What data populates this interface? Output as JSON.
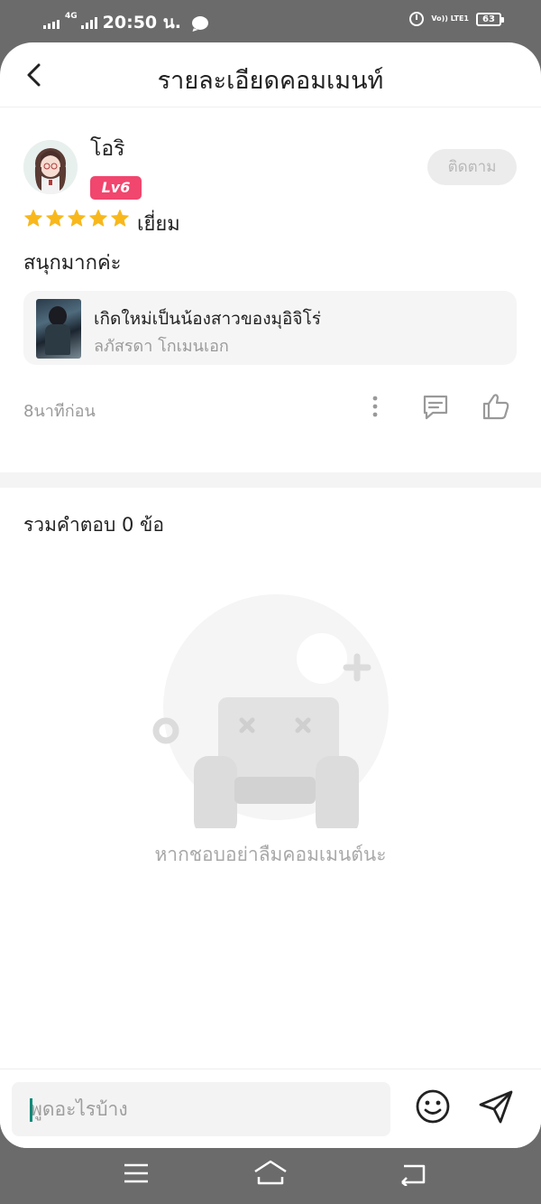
{
  "status_bar": {
    "network_label": "4G",
    "time": "20:50 น.",
    "volte_label": "Vo)) LTE1",
    "battery": "63"
  },
  "header": {
    "title": "รายละเอียดคอมเมนท์",
    "back_icon": "chevron-left-icon"
  },
  "comment": {
    "username": "โอริ",
    "level_badge": "Lv6",
    "follow_label": "ติดตาม",
    "stars": 5,
    "rating_label": "เยี่ยม",
    "text": "สนุกมากค่ะ",
    "time_ago": "8นาทีก่อน",
    "book": {
      "title": "เกิดใหม่เป็นน้องสาวของมุอิจิโร่",
      "author": "ลภัสรดา โกเมนเอก"
    }
  },
  "replies": {
    "count_label": "รวมคำตอบ 0 ข้อ",
    "empty_text": "หากชอบอย่าลืมคอมเมนต์นะ"
  },
  "input_bar": {
    "placeholder": "พูดอะไรบ้าง"
  },
  "colors": {
    "star": "#f8b81c",
    "level_badge": "#f1466e",
    "follow_bg": "#ececec",
    "system_bar": "#6b6b6b"
  }
}
